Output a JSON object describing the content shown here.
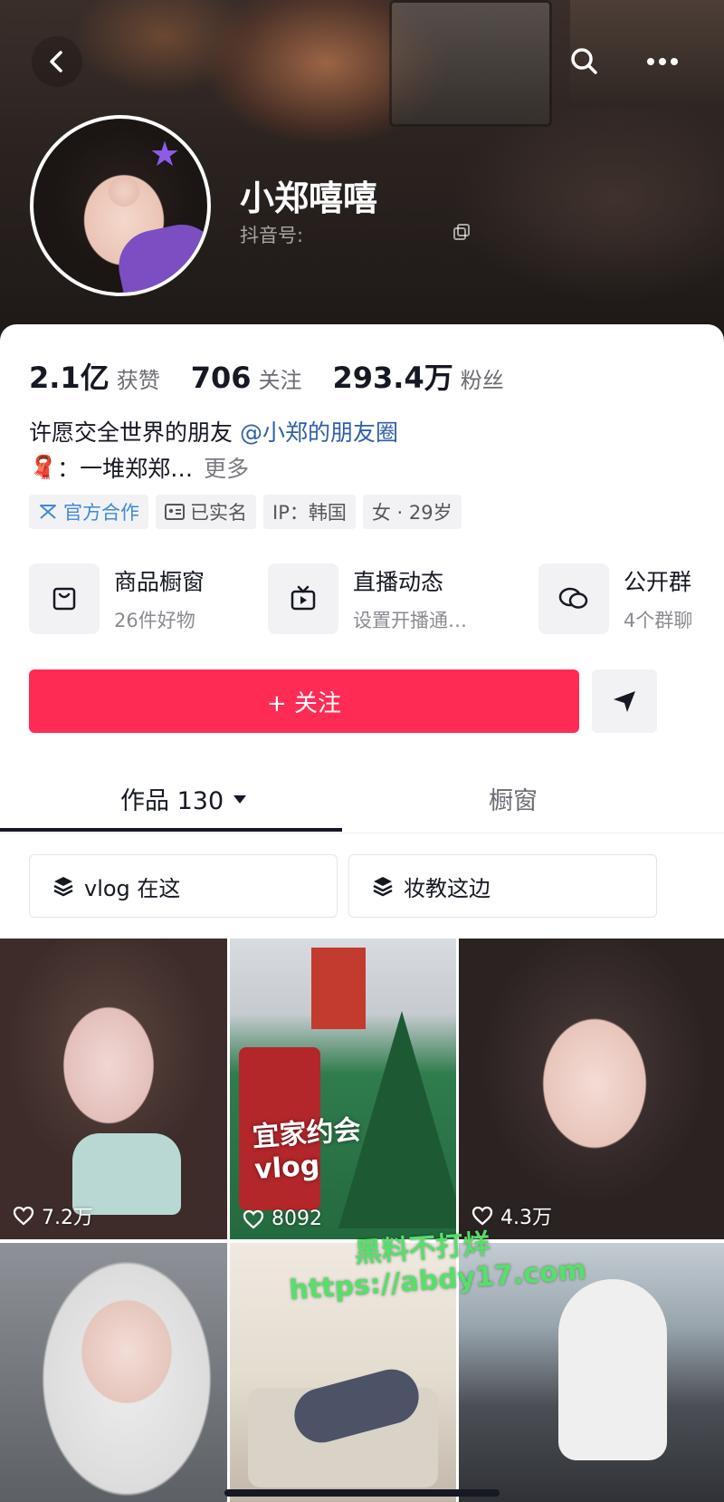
{
  "header": {
    "username": "小郑嘻嘻",
    "douyin_id_label": "抖音号:"
  },
  "icons": {
    "back": "back-arrow-icon",
    "search": "search-icon",
    "more": "more-dots-icon",
    "copy": "copy-icon"
  },
  "stats": [
    {
      "value": "2.1亿",
      "label": "获赞"
    },
    {
      "value": "706",
      "label": "关注"
    },
    {
      "value": "293.4万",
      "label": "粉丝"
    }
  ],
  "bio": {
    "line1_text": "许愿交全世界的朋友 ",
    "line1_mention": "@小郑的朋友圈",
    "line2_emoji": "🧣",
    "line2_text": "：一堆郑郑…",
    "more_label": "更多"
  },
  "tags": [
    {
      "label": "官方合作",
      "icon": "official-partner-icon"
    },
    {
      "label": "已实名",
      "icon": "id-card-icon"
    },
    {
      "label": "IP：韩国"
    },
    {
      "label": "女 · 29岁"
    }
  ],
  "features": [
    {
      "title": "商品橱窗",
      "subtitle": "26件好物",
      "icon": "shopping-bag-icon"
    },
    {
      "title": "直播动态",
      "subtitle": "设置开播通…",
      "icon": "live-tv-icon"
    },
    {
      "title": "公开群",
      "subtitle": "4个群聊",
      "icon": "group-chat-icon"
    }
  ],
  "actions": {
    "follow_label": "+ 关注",
    "share_icon": "send-icon"
  },
  "tabs": {
    "works_label": "作品 130",
    "shop_label": "橱窗"
  },
  "collections": [
    {
      "label": "vlog 在这",
      "icon": "stack-icon"
    },
    {
      "label": "妆教这边",
      "icon": "stack-icon"
    }
  ],
  "videos": [
    {
      "likes": "7.2万"
    },
    {
      "likes": "8092",
      "overlay_line1": "宜家约会",
      "overlay_line2": "vlog"
    },
    {
      "likes": "4.3万"
    },
    {
      "likes": ""
    },
    {
      "likes": ""
    },
    {
      "likes": ""
    }
  ],
  "watermark": {
    "line1": "黑料不打烊",
    "line2": "https://abdy17.com"
  },
  "colors": {
    "accent": "#fe2c55",
    "mention": "#2e5fa8",
    "official_tag": "#3e8ad6",
    "watermark": "#56e06a"
  }
}
